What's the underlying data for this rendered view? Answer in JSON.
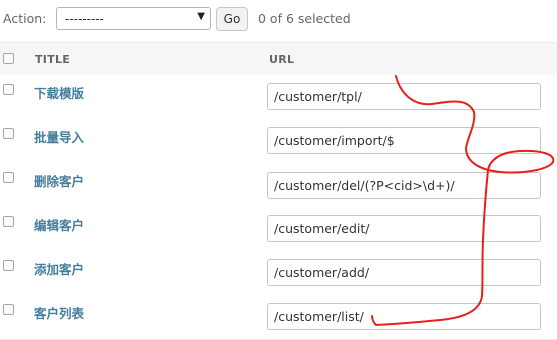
{
  "actions": {
    "label": "Action:",
    "select_value": "---------",
    "go_label": "Go",
    "counter": "0 of 6 selected"
  },
  "table": {
    "columns": [
      "TITLE",
      "URL"
    ],
    "rows": [
      {
        "title": "下载模版",
        "url": "/customer/tpl/"
      },
      {
        "title": "批量导入",
        "url": "/customer/import/$"
      },
      {
        "title": "删除客户",
        "url": "/customer/del/(?P<cid>\\d+)/"
      },
      {
        "title": "编辑客户",
        "url": "/customer/edit/"
      },
      {
        "title": "添加客户",
        "url": "/customer/add/"
      },
      {
        "title": "客户列表",
        "url": "/customer/list/"
      }
    ]
  },
  "colors": {
    "link": "#447e9b",
    "annotation_stroke": "#e8201a"
  },
  "icons": {
    "select_caret": "▼"
  }
}
